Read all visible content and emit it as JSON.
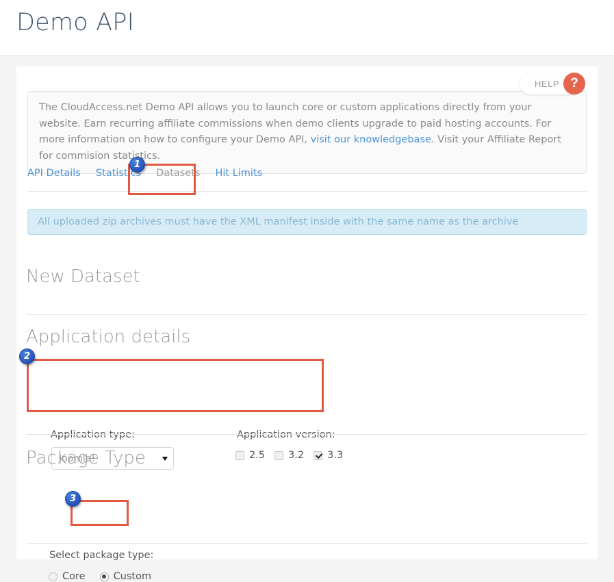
{
  "header": {
    "title": "Demo API"
  },
  "help": {
    "label": "HELP",
    "badge_glyph": "?",
    "badge_color": "#e4674d"
  },
  "intro": {
    "text_before_link": "The CloudAccess.net Demo API allows you to launch core or custom applications directly from your website. Earn recurring affiliate commissions when demo clients upgrade to paid hosting accounts. For more information on how to configure your Demo API, ",
    "link_text": "visit our knowledgebase",
    "text_after_link": ". Visit your Affiliate Report for commision statistics."
  },
  "tabs": [
    {
      "label": "API Details",
      "active": false
    },
    {
      "label": "Statistics",
      "active": false
    },
    {
      "label": "Datasets",
      "active": true
    },
    {
      "label": "Hit Limits",
      "active": false
    }
  ],
  "alert": {
    "text": "All uploaded zip archives must have the XML manifest inside with the same name as the archive"
  },
  "sections": {
    "new_dataset_title": "New Dataset",
    "application_details_title": "Application details",
    "package_type_title": "Package Type"
  },
  "form": {
    "app_type_label": "Application type:",
    "app_type_value": "Joomla!",
    "app_version_label": "Application version:",
    "versions": [
      {
        "label": "2.5",
        "checked": false
      },
      {
        "label": "3.2",
        "checked": false
      },
      {
        "label": "3.3",
        "checked": true
      }
    ],
    "package_label": "Select package type:",
    "package_options": [
      {
        "label": "Core",
        "selected": false
      },
      {
        "label": "Custom",
        "selected": true
      }
    ]
  },
  "annotations": [
    {
      "number": "1",
      "target": "datasets-tab"
    },
    {
      "number": "2",
      "target": "application-details-fields"
    },
    {
      "number": "3",
      "target": "custom-package-option"
    }
  ],
  "colors": {
    "highlight": "#e05a43",
    "badge": "#2f62c4",
    "link": "#4d94d4"
  }
}
